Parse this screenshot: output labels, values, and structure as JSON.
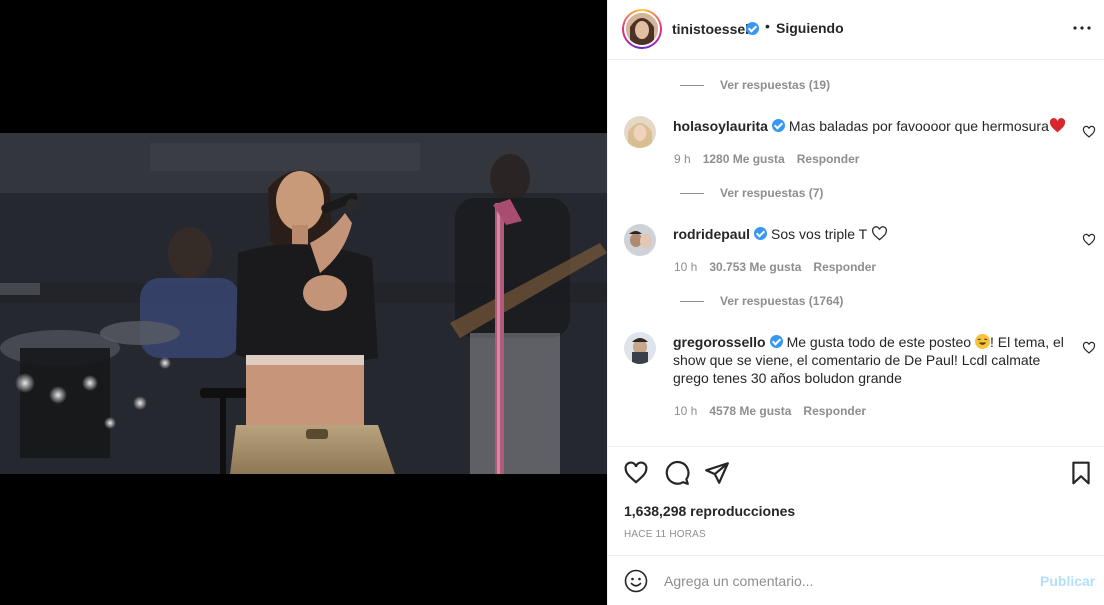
{
  "post": {
    "username": "tinistoessel",
    "follow_status": "Siguiendo",
    "separator": "•"
  },
  "comments": [
    {
      "type": "view_replies",
      "label": "Ver respuestas (19)"
    },
    {
      "type": "comment",
      "username": "holasoylaurita",
      "text": "Mas baladas por favoooor que hermosura",
      "emoji": "red-heart",
      "time": "9 h",
      "likes": "1280 Me gusta",
      "reply": "Responder"
    },
    {
      "type": "view_replies",
      "label": "Ver respuestas (7)"
    },
    {
      "type": "comment",
      "username": "rodridepaul",
      "text": "Sos vos triple T",
      "emoji": "white-heart",
      "time": "10 h",
      "likes": "30.753 Me gusta",
      "reply": "Responder"
    },
    {
      "type": "view_replies",
      "label": "Ver respuestas (1764)"
    },
    {
      "type": "comment",
      "username": "gregorossello",
      "text_part1": "Me gusta todo de este posteo",
      "emoji": "laughing-face",
      "text_part2": "! El tema, el show que se viene, el comentario de De Paul! Lcdl calmate grego tenes 30 años boludon grande",
      "time": "10 h",
      "likes": "4578 Me gusta",
      "reply": "Responder"
    }
  ],
  "actions": {
    "icons": [
      "heart-icon",
      "comment-icon",
      "share-icon",
      "bookmark-icon"
    ],
    "views": "1,638,298 reproducciones",
    "time_ago": "HACE 11 HORAS"
  },
  "composer": {
    "placeholder": "Agrega un comentario...",
    "publish_label": "Publicar",
    "publish_color": "#b2dffc"
  },
  "colors": {
    "verified": "#3897f0",
    "muted": "#8e8e8e",
    "text": "#262626",
    "heart_red": "#ed4956"
  }
}
